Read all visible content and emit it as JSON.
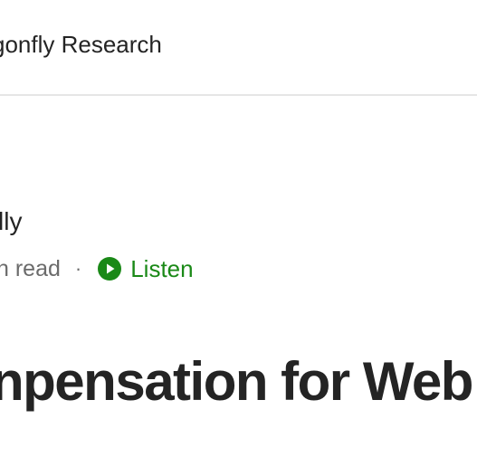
{
  "header": {
    "publication_name": "gonfly Research"
  },
  "byline": {
    "author_name": "lly",
    "read_time": "n read",
    "separator": "·",
    "listen_label": "Listen",
    "listen_color": "#1a8917"
  },
  "article": {
    "title": "npensation for Web"
  }
}
